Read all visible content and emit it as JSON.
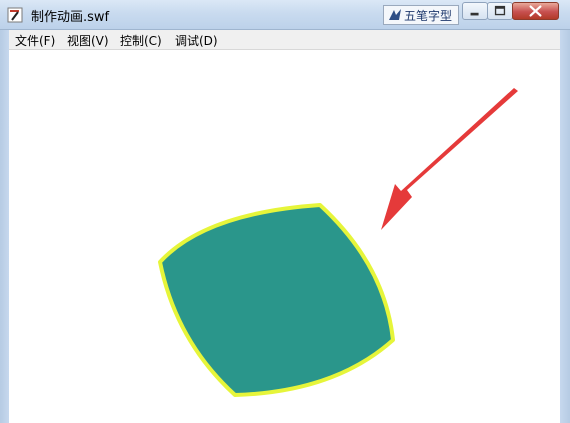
{
  "window": {
    "title": "制作动画.swf",
    "ime_label": "五笔字型"
  },
  "menu": {
    "items": [
      "文件(F)",
      "视图(V)",
      "控制(C)",
      "调试(D)"
    ]
  },
  "colors": {
    "shape_fill": "#2a968b",
    "shape_outline": "#e6f53a",
    "arrow": "#e53a3a"
  },
  "icons": [
    "flash-player-icon",
    "ime-icon",
    "minimize-icon",
    "maximize-icon",
    "close-icon"
  ]
}
